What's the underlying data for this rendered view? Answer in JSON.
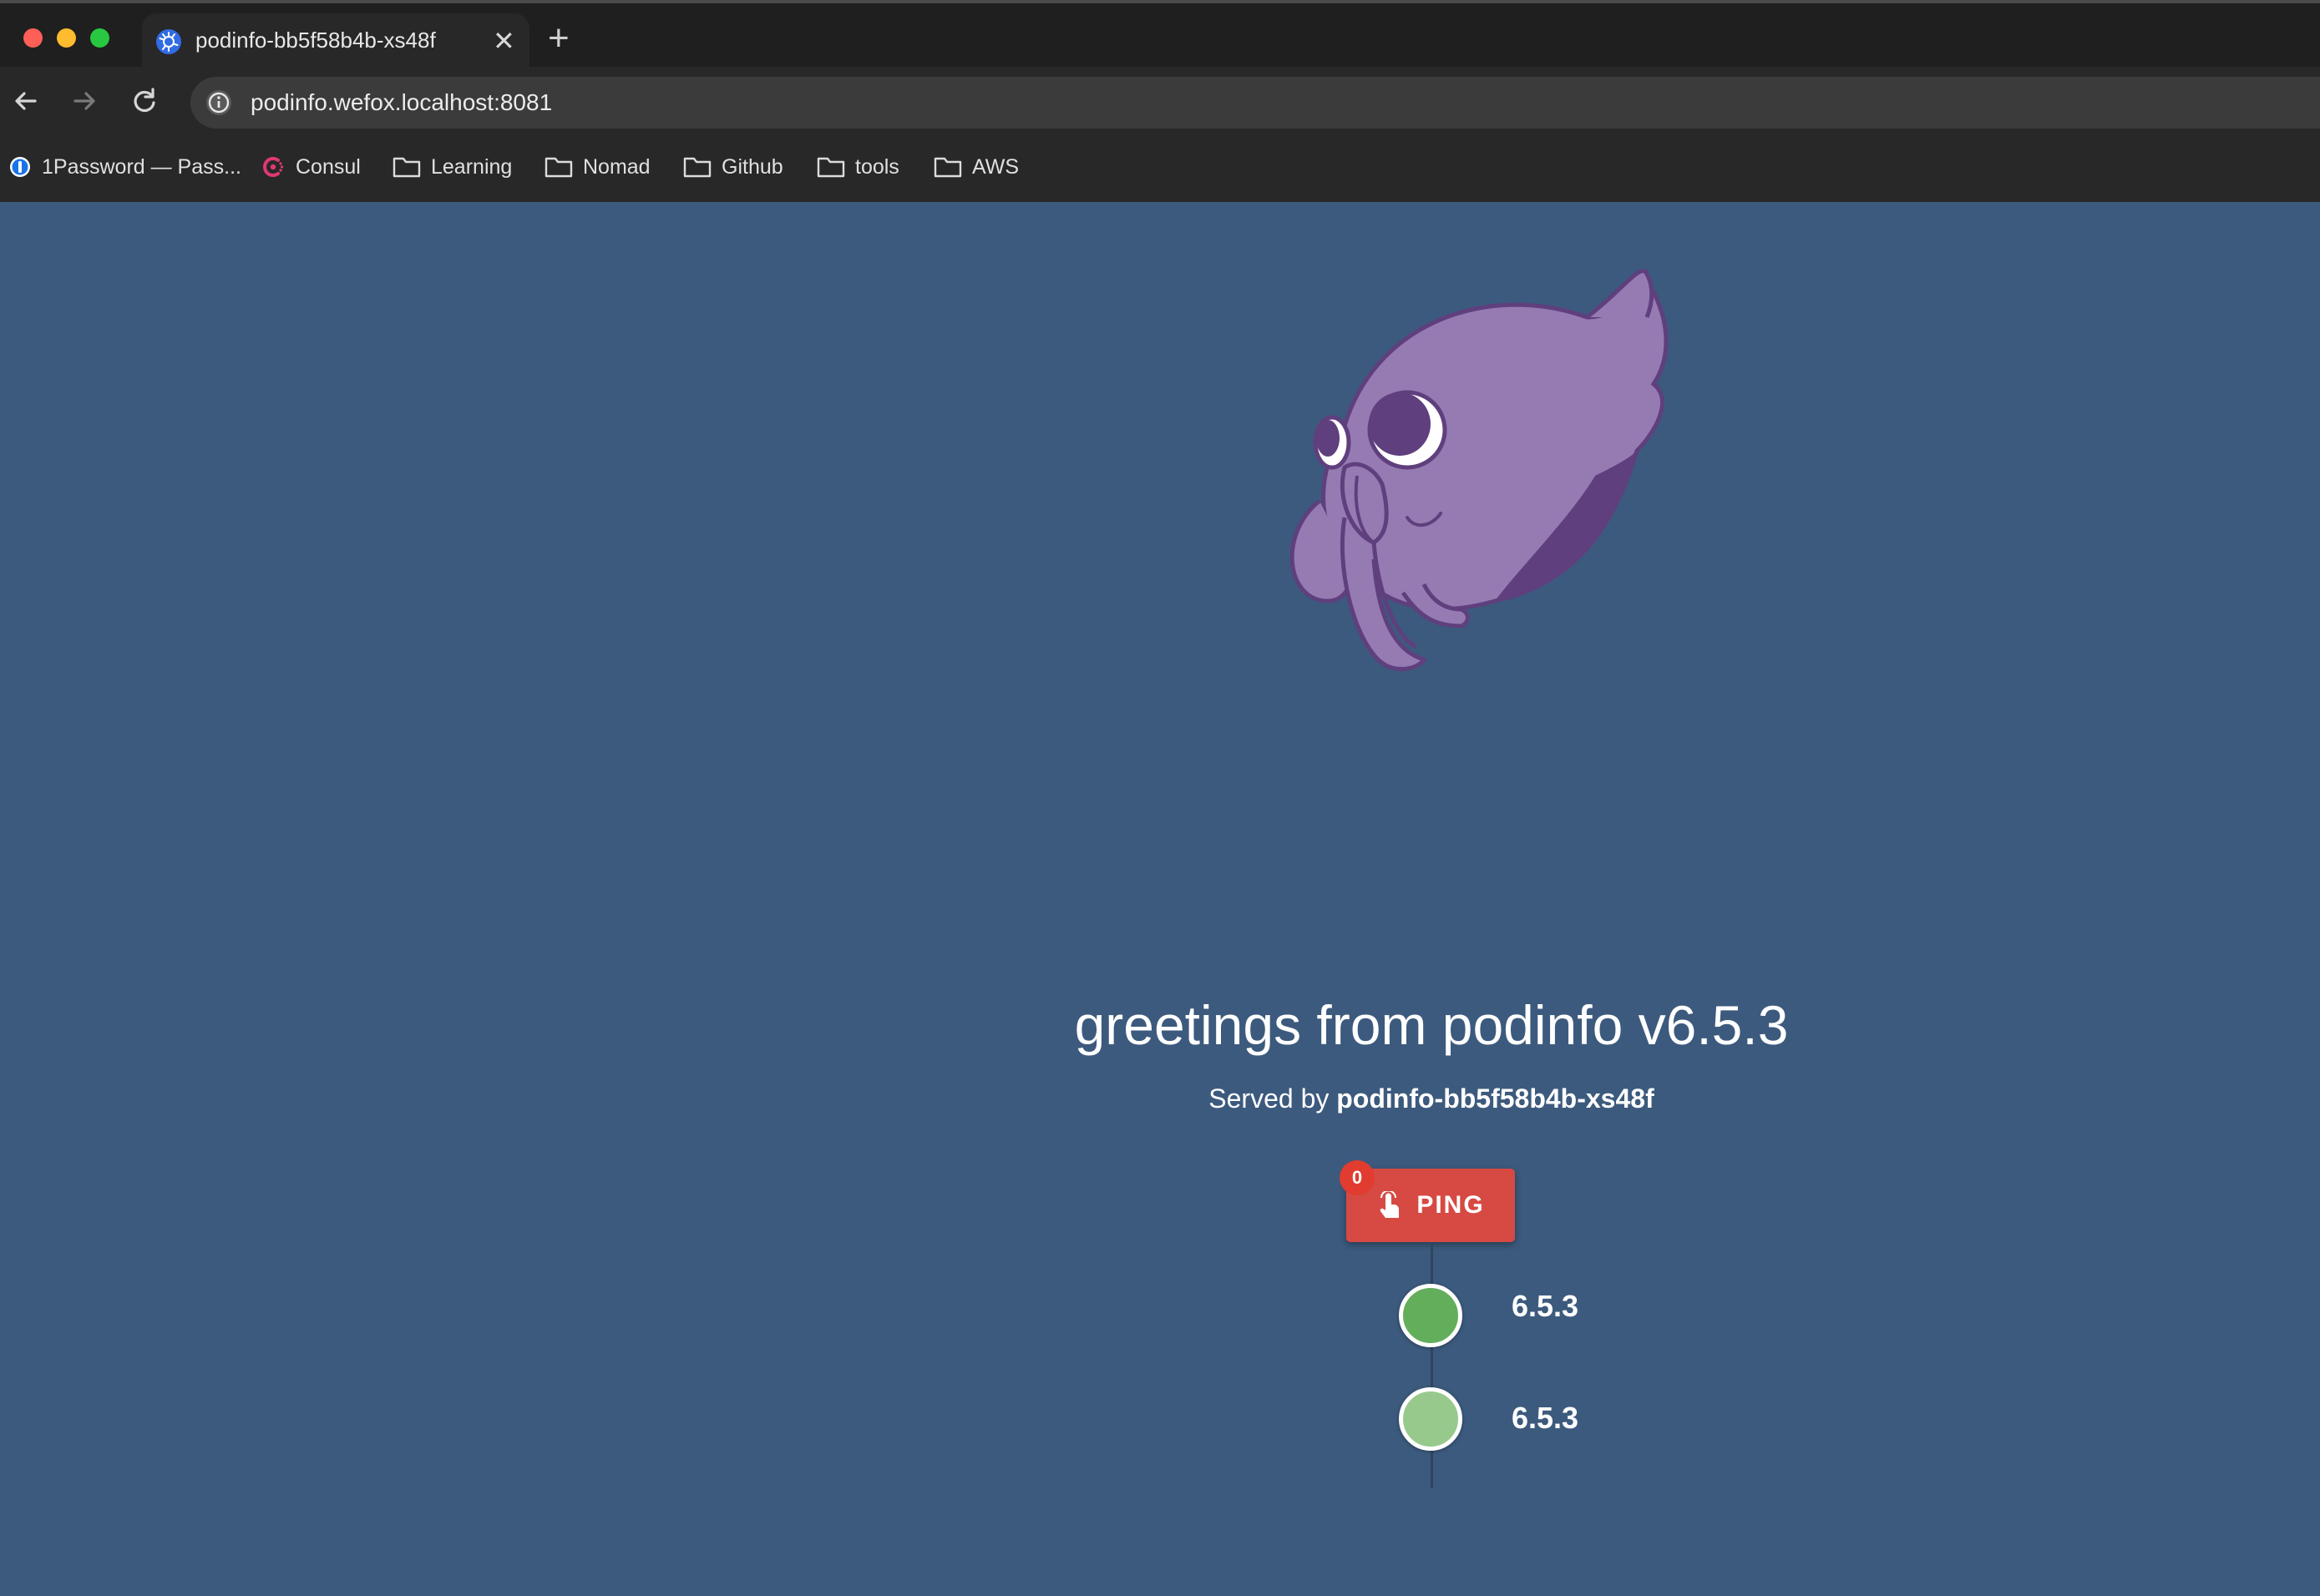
{
  "browser": {
    "tab_title": "podinfo-bb5f58b4b-xs48f",
    "url": "podinfo.wefox.localhost:8081",
    "bookmarks": [
      {
        "label": "1Password — Pass...",
        "icon": "1password-icon"
      },
      {
        "label": "Consul",
        "icon": "consul-icon"
      },
      {
        "label": "Learning",
        "icon": "folder-icon"
      },
      {
        "label": "Nomad",
        "icon": "folder-icon"
      },
      {
        "label": "Github",
        "icon": "folder-icon"
      },
      {
        "label": "tools",
        "icon": "folder-icon"
      },
      {
        "label": "AWS",
        "icon": "folder-icon"
      }
    ]
  },
  "main": {
    "greeting": "greetings from podinfo v6.5.3",
    "served_prefix": "Served by",
    "served_pod": "podinfo-bb5f58b4b-xs48f",
    "ping_label": "PING",
    "ping_count": "0",
    "responses": [
      {
        "version": "6.5.3",
        "color": "#63ae5b"
      },
      {
        "version": "6.5.3",
        "color": "#97c98c"
      }
    ]
  },
  "colors": {
    "page_background": "#3c5a7d",
    "ping_button": "#d64a43",
    "mascot_purple": "#957bb1",
    "mascot_dark": "#5f3f7e"
  }
}
